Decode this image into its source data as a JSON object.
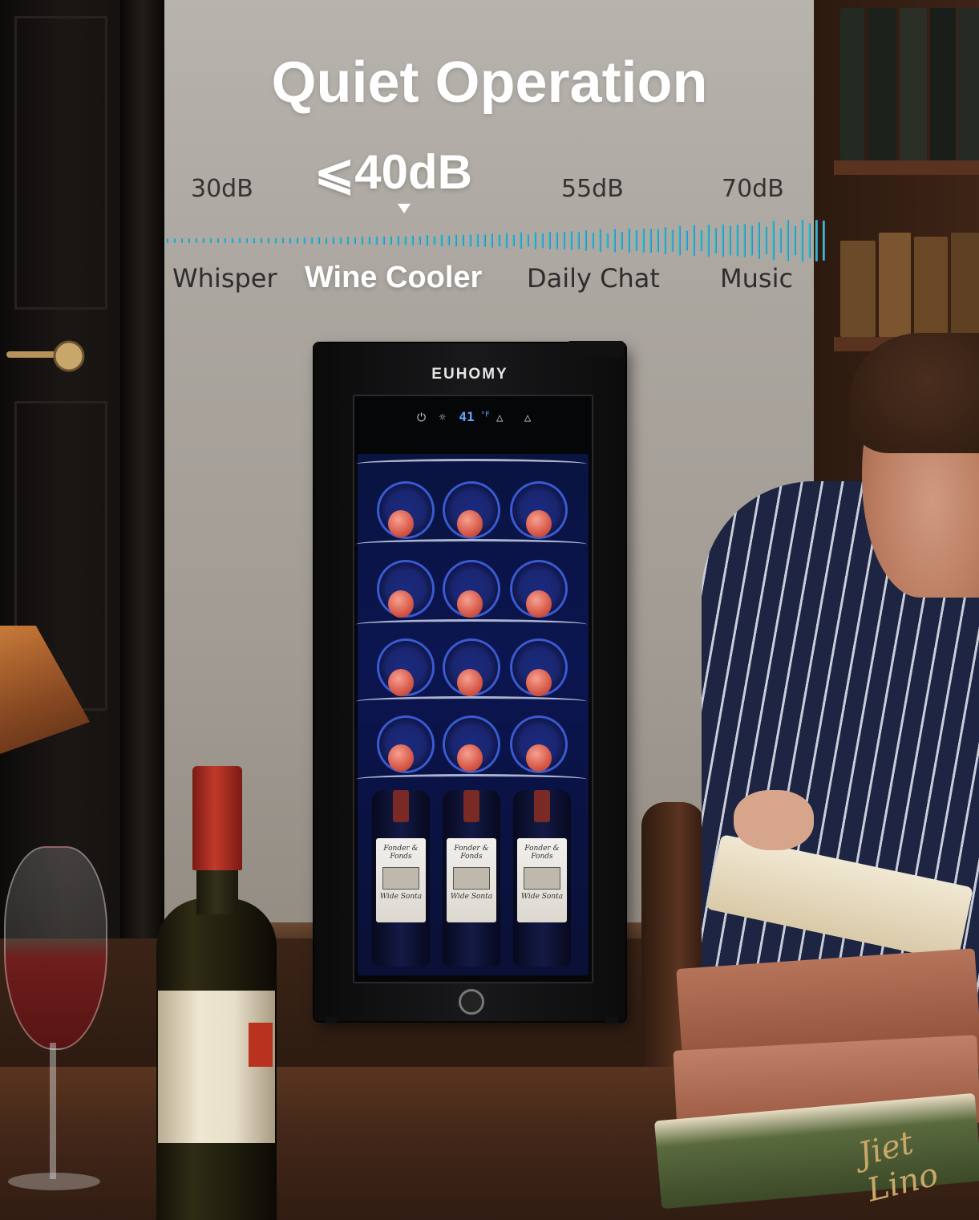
{
  "headline": "Quiet Operation",
  "scale": {
    "highlight": "⩽40dB",
    "levels": [
      "30dB",
      "55dB",
      "70dB"
    ],
    "categories": [
      "Whisper",
      "Daily Chat",
      "Music"
    ],
    "highlight_category": "Wine Cooler"
  },
  "product": {
    "brand": "EUHOMY",
    "display_temp": "41",
    "display_unit": "°F",
    "bottle_label_top": "Fonder & Fonds",
    "bottle_label_name": "Wide Sonta"
  },
  "decor": {
    "book_spine_title": "Jiet Lino"
  },
  "colors": {
    "wave_start": "#4fd9a8",
    "wave_end": "#2a7fe0",
    "text_light": "#ffffff",
    "text_dark": "#333333"
  }
}
